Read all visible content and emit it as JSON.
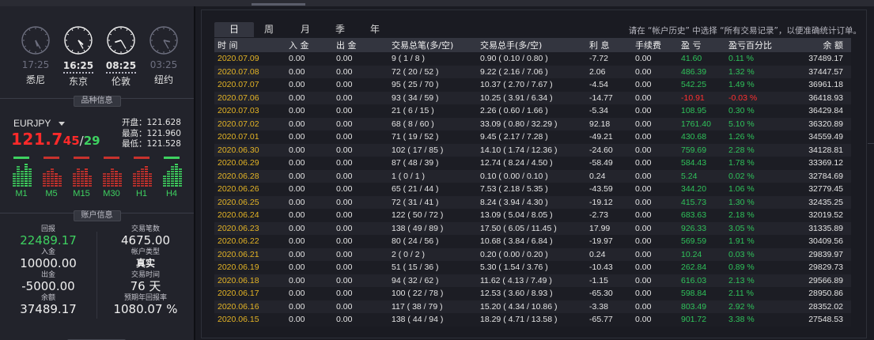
{
  "clocks": [
    {
      "time": "17:25",
      "city": "悉尼",
      "active": false,
      "h": 17,
      "m": 25
    },
    {
      "time": "16:25",
      "city": "东京",
      "active": true,
      "h": 16,
      "m": 25
    },
    {
      "time": "08:25",
      "city": "伦敦",
      "active": true,
      "h": 8,
      "m": 25
    },
    {
      "time": "03:25",
      "city": "纽约",
      "active": false,
      "h": 3,
      "m": 25
    }
  ],
  "sections": {
    "symbol_info": "品种信息",
    "account_info": "账户信息"
  },
  "quote": {
    "symbol": "EURJPY",
    "price_main": "121.7",
    "price_bid_tail": "45",
    "slash": "/",
    "price_ask_tail": "29",
    "open": "开盘：121.628",
    "high": "最高：121.960",
    "low": "最低：121.528"
  },
  "timeframes": [
    {
      "label": "M1",
      "color": "#3ed160",
      "bars": [
        0.55,
        0.85,
        0.7,
        1.0,
        0.8
      ]
    },
    {
      "label": "M5",
      "color": "#c8322d",
      "bars": [
        0.55,
        0.7,
        0.8,
        0.6,
        0.5
      ]
    },
    {
      "label": "M15",
      "color": "#c8322d",
      "bars": [
        0.55,
        0.75,
        0.65,
        0.8,
        0.5
      ]
    },
    {
      "label": "M30",
      "color": "#c8322d",
      "bars": [
        0.55,
        0.6,
        0.8,
        0.7,
        0.55
      ]
    },
    {
      "label": "H1",
      "color": "#c8322d",
      "bars": [
        0.55,
        0.65,
        0.8,
        0.9,
        0.6
      ]
    },
    {
      "label": "H4",
      "color": "#3ed160",
      "bars": [
        0.5,
        0.7,
        0.85,
        1.0,
        0.75
      ]
    }
  ],
  "account": {
    "profit_label": "回报",
    "profit": "22489.17",
    "trades_label": "交易笔数",
    "trades": "4675.00",
    "deposit_label": "入金",
    "deposit": "10000.00",
    "acct_type_label": "帐户类型",
    "acct_type": "真实",
    "withdraw_label": "出金",
    "withdraw": "-5000.00",
    "time_label": "交易时间",
    "time": "76 天",
    "balance_label": "余额",
    "balance": "37489.17",
    "annual_label": "预期年回报率",
    "annual": "1080.07 %"
  },
  "tabs": [
    "日",
    "周",
    "月",
    "季",
    "年"
  ],
  "active_tab": 0,
  "hint": "请在 “帐户历史” 中选择 “所有交易记录”，以便准确统计订单。",
  "columns": [
    "时 间",
    "入 金",
    "出 金",
    "交易总笔(多/空)",
    "交易总手(多/空)",
    "利 息",
    "手续费",
    "盈 亏",
    "盈亏百分比",
    "余 额"
  ],
  "rows": [
    [
      "2020.07.09",
      "0.00",
      "0.00",
      "9   ( 1 / 8 )",
      "0.90   ( 0.10 / 0.80 )",
      "-7.72",
      "0.00",
      "41.60",
      "0.11 %",
      "37489.17"
    ],
    [
      "2020.07.08",
      "0.00",
      "0.00",
      "72   ( 20 / 52 )",
      "9.22   ( 2.16 / 7.06 )",
      "2.06",
      "0.00",
      "486.39",
      "1.32 %",
      "37447.57"
    ],
    [
      "2020.07.07",
      "0.00",
      "0.00",
      "95   ( 25 / 70 )",
      "10.37   ( 2.70 / 7.67 )",
      "-4.54",
      "0.00",
      "542.25",
      "1.49 %",
      "36961.18"
    ],
    [
      "2020.07.06",
      "0.00",
      "0.00",
      "93   ( 34 / 59 )",
      "10.25   ( 3.91 / 6.34 )",
      "-14.77",
      "0.00",
      "-10.91",
      "-0.03 %",
      "36418.93"
    ],
    [
      "2020.07.03",
      "0.00",
      "0.00",
      "21   ( 6 / 15 )",
      "2.26   ( 0.60 / 1.66 )",
      "-5.34",
      "0.00",
      "108.95",
      "0.30 %",
      "36429.84"
    ],
    [
      "2020.07.02",
      "0.00",
      "0.00",
      "68   ( 8 / 60 )",
      "33.09   ( 0.80 / 32.29 )",
      "92.18",
      "0.00",
      "1761.40",
      "5.10 %",
      "36320.89"
    ],
    [
      "2020.07.01",
      "0.00",
      "0.00",
      "71   ( 19 / 52 )",
      "9.45   ( 2.17 / 7.28 )",
      "-49.21",
      "0.00",
      "430.68",
      "1.26 %",
      "34559.49"
    ],
    [
      "2020.06.30",
      "0.00",
      "0.00",
      "102   ( 17 / 85 )",
      "14.10   ( 1.74 / 12.36 )",
      "-24.60",
      "0.00",
      "759.69",
      "2.28 %",
      "34128.81"
    ],
    [
      "2020.06.29",
      "0.00",
      "0.00",
      "87   ( 48 / 39 )",
      "12.74   ( 8.24 / 4.50 )",
      "-58.49",
      "0.00",
      "584.43",
      "1.78 %",
      "33369.12"
    ],
    [
      "2020.06.28",
      "0.00",
      "0.00",
      "1   ( 0 / 1 )",
      "0.10   ( 0.00 / 0.10 )",
      "0.24",
      "0.00",
      "5.24",
      "0.02 %",
      "32784.69"
    ],
    [
      "2020.06.26",
      "0.00",
      "0.00",
      "65   ( 21 / 44 )",
      "7.53   ( 2.18 / 5.35 )",
      "-43.59",
      "0.00",
      "344.20",
      "1.06 %",
      "32779.45"
    ],
    [
      "2020.06.25",
      "0.00",
      "0.00",
      "72   ( 31 / 41 )",
      "8.24   ( 3.94 / 4.30 )",
      "-19.12",
      "0.00",
      "415.73",
      "1.30 %",
      "32435.25"
    ],
    [
      "2020.06.24",
      "0.00",
      "0.00",
      "122   ( 50 / 72 )",
      "13.09   ( 5.04 / 8.05 )",
      "-2.73",
      "0.00",
      "683.63",
      "2.18 %",
      "32019.52"
    ],
    [
      "2020.06.23",
      "0.00",
      "0.00",
      "138   ( 49 / 89 )",
      "17.50   ( 6.05 / 11.45 )",
      "17.99",
      "0.00",
      "926.33",
      "3.05 %",
      "31335.89"
    ],
    [
      "2020.06.22",
      "0.00",
      "0.00",
      "80   ( 24 / 56 )",
      "10.68   ( 3.84 / 6.84 )",
      "-19.97",
      "0.00",
      "569.59",
      "1.91 %",
      "30409.56"
    ],
    [
      "2020.06.21",
      "0.00",
      "0.00",
      "2   ( 0 / 2 )",
      "0.20   ( 0.00 / 0.20 )",
      "0.24",
      "0.00",
      "10.24",
      "0.03 %",
      "29839.97"
    ],
    [
      "2020.06.19",
      "0.00",
      "0.00",
      "51   ( 15 / 36 )",
      "5.30   ( 1.54 / 3.76 )",
      "-10.43",
      "0.00",
      "262.84",
      "0.89 %",
      "29829.73"
    ],
    [
      "2020.06.18",
      "0.00",
      "0.00",
      "94   ( 32 / 62 )",
      "11.62   ( 4.13 / 7.49 )",
      "-1.15",
      "0.00",
      "616.03",
      "2.13 %",
      "29566.89"
    ],
    [
      "2020.06.17",
      "0.00",
      "0.00",
      "100   ( 22 / 78 )",
      "12.53   ( 3.60 / 8.93 )",
      "-65.30",
      "0.00",
      "598.84",
      "2.11 %",
      "28950.86"
    ],
    [
      "2020.06.16",
      "0.00",
      "0.00",
      "117   ( 38 / 79 )",
      "15.20   ( 4.34 / 10.86 )",
      "-3.38",
      "0.00",
      "803.49",
      "2.92 %",
      "28352.02"
    ],
    [
      "2020.06.15",
      "0.00",
      "0.00",
      "138   ( 44 / 94 )",
      "18.29   ( 4.71 / 13.58 )",
      "-65.77",
      "0.00",
      "901.72",
      "3.38 %",
      "27548.53"
    ]
  ]
}
